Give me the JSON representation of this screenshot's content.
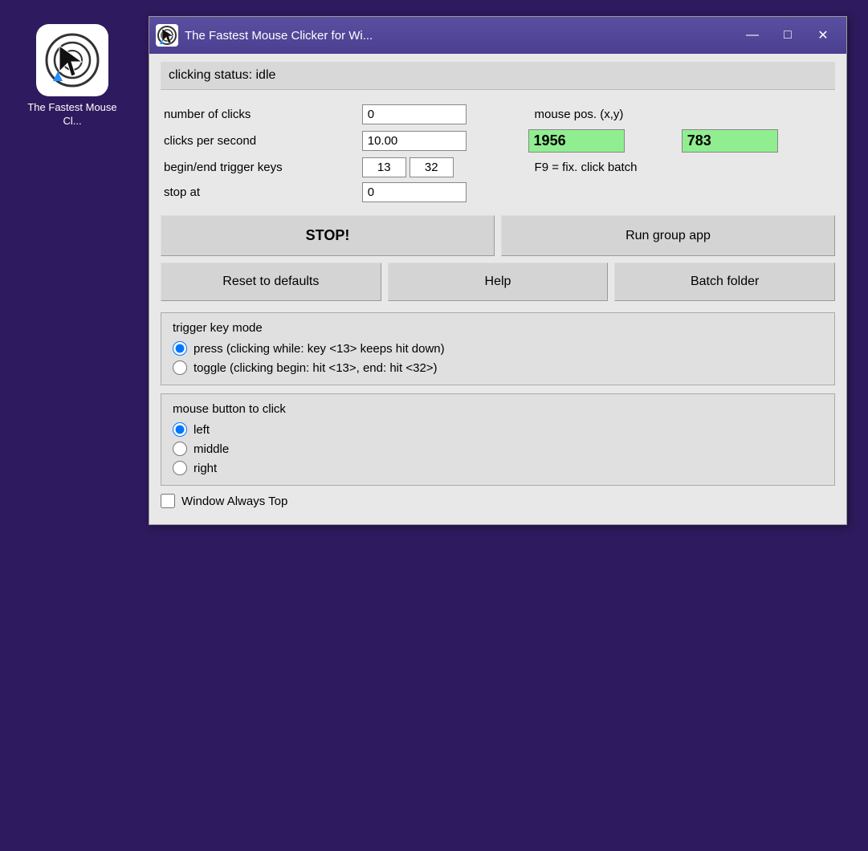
{
  "desktop": {
    "icon_label": "The Fastest\nMouse Cl..."
  },
  "titlebar": {
    "title": "The Fastest Mouse Clicker for Wi...",
    "minimize_label": "—",
    "maximize_label": "□",
    "close_label": "✕"
  },
  "status": {
    "text": "clicking status: idle"
  },
  "form": {
    "num_clicks_label": "number of clicks",
    "num_clicks_value": "0",
    "cps_label": "clicks per second",
    "cps_value": "10.00",
    "mouse_pos_label": "mouse pos. (x,y)",
    "mouse_x": "1956",
    "mouse_y": "783",
    "trigger_keys_label": "begin/end trigger keys",
    "trigger_key1": "13",
    "trigger_key2": "32",
    "f9_label": "F9 = fix. click batch",
    "stop_at_label": "stop at",
    "stop_at_value": "0"
  },
  "buttons": {
    "stop_label": "STOP!",
    "run_group_label": "Run group app",
    "reset_label": "Reset to defaults",
    "help_label": "Help",
    "batch_folder_label": "Batch folder"
  },
  "trigger_key_mode": {
    "title": "trigger key mode",
    "option1": "press (clicking while: key <13> keeps hit down)",
    "option2": "toggle (clicking begin: hit <13>, end: hit <32>)"
  },
  "mouse_button": {
    "title": "mouse button to click",
    "option1": "left",
    "option2": "middle",
    "option3": "right"
  },
  "window_always_top": {
    "label": "Window Always Top"
  }
}
